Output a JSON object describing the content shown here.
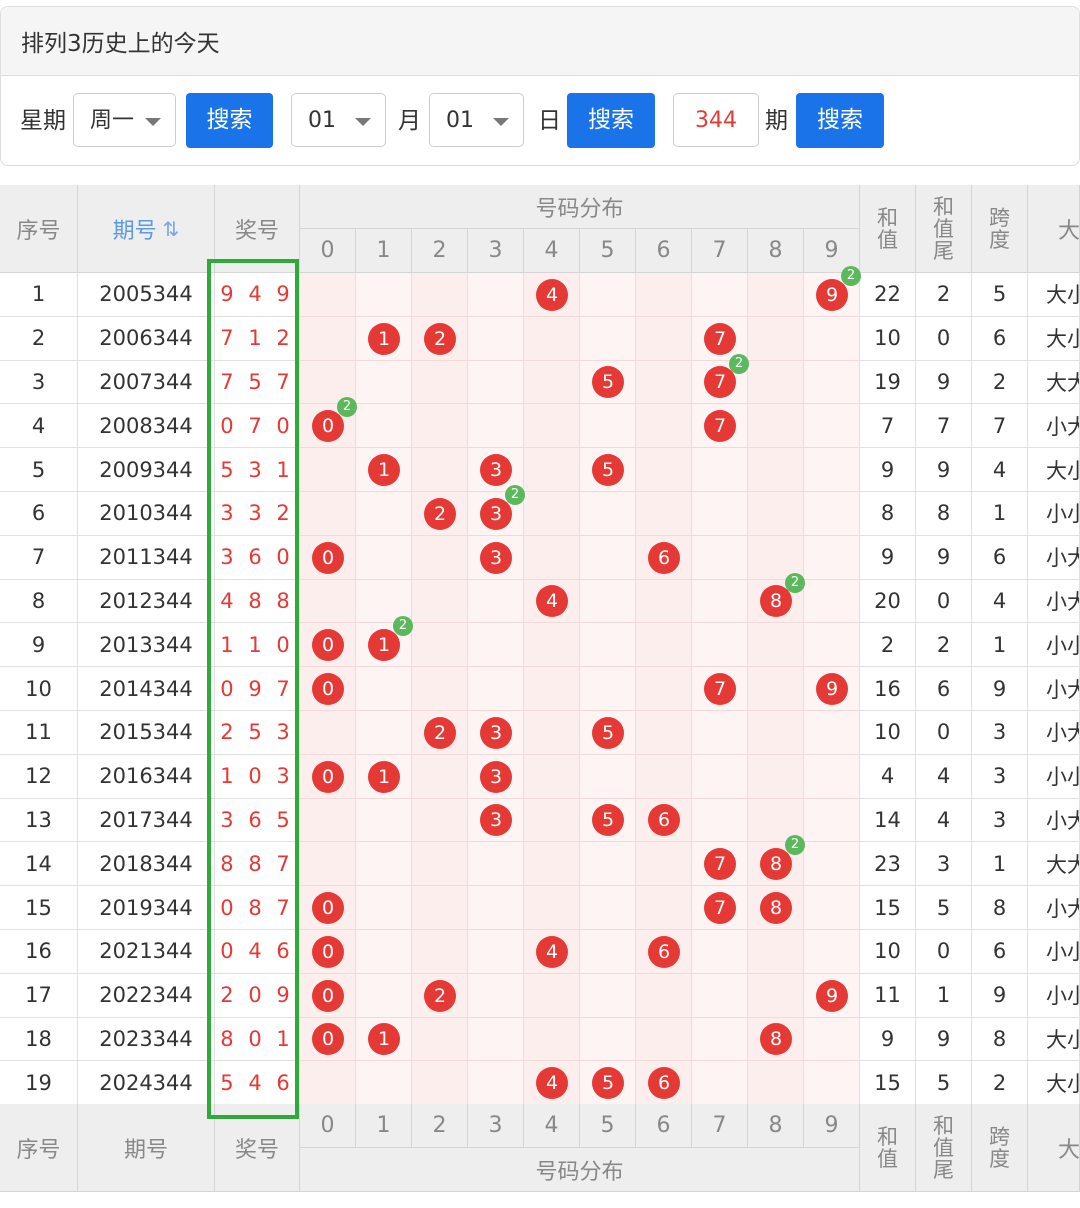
{
  "panel": {
    "title": "排列3历史上的今天",
    "week_label": "星期",
    "week_value": "周一",
    "month_value": "01",
    "month_label": "月",
    "day_value": "01",
    "day_label": "日",
    "issue_value": "344",
    "issue_label": "期",
    "search_label": "搜索"
  },
  "table": {
    "headers": {
      "seq": "序号",
      "issue": "期号",
      "prize": "奖号",
      "dist": "号码分布",
      "sum": "和值",
      "sum_tail": "和值尾",
      "span": "跨度",
      "big": "大"
    },
    "digits": [
      "0",
      "1",
      "2",
      "3",
      "4",
      "5",
      "6",
      "7",
      "8",
      "9"
    ],
    "rows": [
      {
        "seq": "1",
        "issue": "2005344",
        "prize": "9 4 9",
        "sum": "22",
        "tail": "2",
        "span": "5",
        "big": "大小"
      },
      {
        "seq": "2",
        "issue": "2006344",
        "prize": "7 1 2",
        "sum": "10",
        "tail": "0",
        "span": "6",
        "big": "大小"
      },
      {
        "seq": "3",
        "issue": "2007344",
        "prize": "7 5 7",
        "sum": "19",
        "tail": "9",
        "span": "2",
        "big": "大大"
      },
      {
        "seq": "4",
        "issue": "2008344",
        "prize": "0 7 0",
        "sum": "7",
        "tail": "7",
        "span": "7",
        "big": "小大"
      },
      {
        "seq": "5",
        "issue": "2009344",
        "prize": "5 3 1",
        "sum": "9",
        "tail": "9",
        "span": "4",
        "big": "大小"
      },
      {
        "seq": "6",
        "issue": "2010344",
        "prize": "3 3 2",
        "sum": "8",
        "tail": "8",
        "span": "1",
        "big": "小小"
      },
      {
        "seq": "7",
        "issue": "2011344",
        "prize": "3 6 0",
        "sum": "9",
        "tail": "9",
        "span": "6",
        "big": "小大"
      },
      {
        "seq": "8",
        "issue": "2012344",
        "prize": "4 8 8",
        "sum": "20",
        "tail": "0",
        "span": "4",
        "big": "小大"
      },
      {
        "seq": "9",
        "issue": "2013344",
        "prize": "1 1 0",
        "sum": "2",
        "tail": "2",
        "span": "1",
        "big": "小小"
      },
      {
        "seq": "10",
        "issue": "2014344",
        "prize": "0 9 7",
        "sum": "16",
        "tail": "6",
        "span": "9",
        "big": "小大"
      },
      {
        "seq": "11",
        "issue": "2015344",
        "prize": "2 5 3",
        "sum": "10",
        "tail": "0",
        "span": "3",
        "big": "小大"
      },
      {
        "seq": "12",
        "issue": "2016344",
        "prize": "1 0 3",
        "sum": "4",
        "tail": "4",
        "span": "3",
        "big": "小小"
      },
      {
        "seq": "13",
        "issue": "2017344",
        "prize": "3 6 5",
        "sum": "14",
        "tail": "4",
        "span": "3",
        "big": "小大"
      },
      {
        "seq": "14",
        "issue": "2018344",
        "prize": "8 8 7",
        "sum": "23",
        "tail": "3",
        "span": "1",
        "big": "大大"
      },
      {
        "seq": "15",
        "issue": "2019344",
        "prize": "0 8 7",
        "sum": "15",
        "tail": "5",
        "span": "8",
        "big": "小大"
      },
      {
        "seq": "16",
        "issue": "2021344",
        "prize": "0 4 6",
        "sum": "10",
        "tail": "0",
        "span": "6",
        "big": "小小"
      },
      {
        "seq": "17",
        "issue": "2022344",
        "prize": "2 0 9",
        "sum": "11",
        "tail": "1",
        "span": "9",
        "big": "小小"
      },
      {
        "seq": "18",
        "issue": "2023344",
        "prize": "8 0 1",
        "sum": "9",
        "tail": "9",
        "span": "8",
        "big": "大小"
      },
      {
        "seq": "19",
        "issue": "2024344",
        "prize": "5 4 6",
        "sum": "15",
        "tail": "5",
        "span": "2",
        "big": "大小"
      }
    ]
  },
  "colors": {
    "ball": "#e53935",
    "badge": "#5cb85c",
    "button": "#1a73e8",
    "highlight_box": "#2eaa3a"
  },
  "icons": {
    "sort": "sort-icon",
    "caret": "chevron-down-icon"
  }
}
